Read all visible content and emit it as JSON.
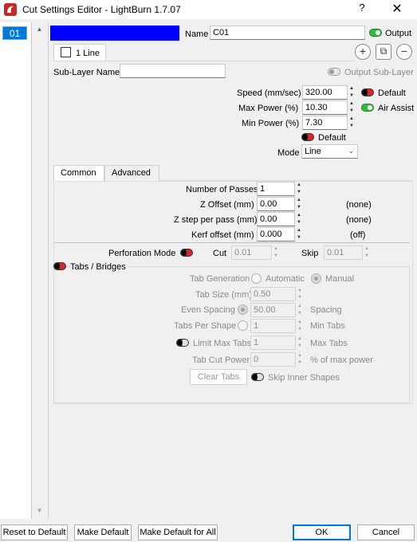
{
  "window": {
    "title": "Cut Settings Editor - LightBurn 1.7.07",
    "help": "?",
    "close": "✕"
  },
  "layers": [
    {
      "label": "01",
      "color": "#0000ff"
    }
  ],
  "header": {
    "name_label": "Name",
    "name_value": "C01",
    "output_label": "Output",
    "sublayer_tab_label": "1 Line",
    "sublayer_name_label": "Sub-Layer Name",
    "sublayer_name_value": "",
    "output_sublayer_label": "Output Sub-Layer",
    "add_icon": "+",
    "copy_icon": "⧉",
    "remove_icon": "−"
  },
  "params": {
    "speed_label": "Speed (mm/sec)",
    "speed_value": "320.00",
    "speed_default_label": "Default",
    "max_power_label": "Max Power (%)",
    "max_power_value": "10.30",
    "air_assist_label": "Air Assist",
    "min_power_label": "Min Power (%)",
    "min_power_value": "7.30",
    "power_default_label": "Default",
    "mode_label": "Mode",
    "mode_value": "Line"
  },
  "tabs": [
    {
      "label": "Common"
    },
    {
      "label": "Advanced"
    }
  ],
  "common": {
    "passes_label": "Number of Passes",
    "passes_value": "1",
    "z_offset_label": "Z Offset (mm)",
    "z_offset_value": "0.00",
    "z_offset_note": "(none)",
    "z_step_label": "Z step per pass (mm)",
    "z_step_value": "0.00",
    "z_step_note": "(none)",
    "kerf_label": "Kerf offset (mm)",
    "kerf_value": "0.000",
    "kerf_note": "(off)",
    "perforation_label": "Perforation Mode",
    "cut_label": "Cut",
    "cut_value": "0.01",
    "skip_label": "Skip",
    "skip_value": "0.01"
  },
  "tabs_bridges": {
    "label": "Tabs / Bridges",
    "generation_label": "Tab Generation",
    "automatic_label": "Automatic",
    "manual_label": "Manual",
    "tab_size_label": "Tab Size (mm)",
    "tab_size_value": "0.50",
    "even_spacing_label": "Even Spacing",
    "even_spacing_value": "50.00",
    "spacing_label": "Spacing",
    "tabs_per_shape_label": "Tabs Per Shape",
    "tabs_per_shape_value": "1",
    "min_tabs_label": "Min Tabs",
    "limit_max_label": "Limit Max Tabs",
    "limit_max_value": "1",
    "max_tabs_label": "Max Tabs",
    "tab_cut_power_label": "Tab Cut Power",
    "tab_cut_power_value": "0",
    "pct_max_power_label": "% of max power",
    "clear_tabs_label": "Clear Tabs",
    "skip_inner_label": "Skip Inner Shapes"
  },
  "footer": {
    "reset_label": "Reset to Default",
    "make_default_label": "Make Default",
    "make_default_all_label": "Make Default for All",
    "ok_label": "OK",
    "cancel_label": "Cancel"
  },
  "colors": {
    "accent": "#0078d7",
    "layer_color": "#0000ff",
    "toggle_on": "#2dbd3a",
    "toggle_off": "#d8262b"
  }
}
